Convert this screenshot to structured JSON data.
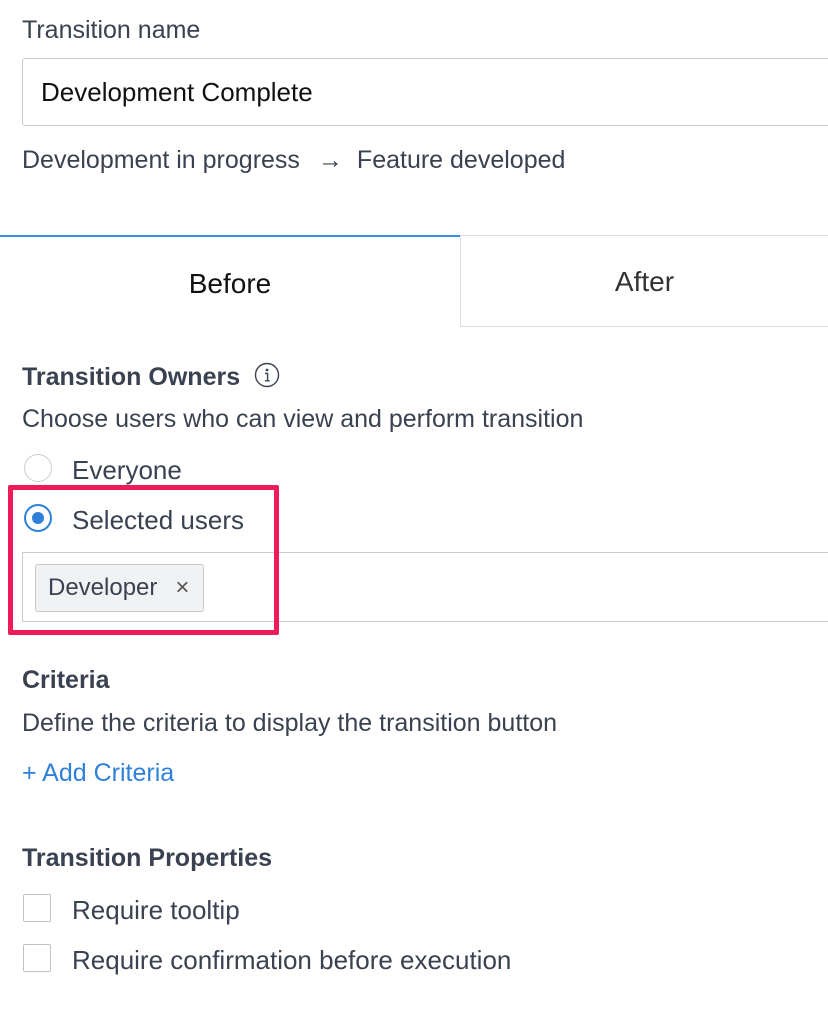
{
  "transition_name": {
    "label": "Transition name",
    "value": "Development Complete"
  },
  "path": {
    "from": "Development in progress",
    "arrow": "→",
    "to": "Feature developed"
  },
  "tabs": [
    {
      "label": "Before",
      "active": true
    },
    {
      "label": "After",
      "active": false
    }
  ],
  "owners": {
    "title": "Transition Owners",
    "info_icon": "info-circle-icon",
    "description": "Choose users who can view and perform transition",
    "options": [
      {
        "label": "Everyone",
        "selected": false
      },
      {
        "label": "Selected users",
        "selected": true
      }
    ],
    "chips": [
      {
        "label": "Developer",
        "remove": "×"
      }
    ]
  },
  "criteria": {
    "title": "Criteria",
    "description": "Define the criteria to display the transition button",
    "add_link": "+ Add Criteria"
  },
  "properties": {
    "title": "Transition Properties",
    "options": [
      {
        "label": "Require tooltip",
        "checked": false
      },
      {
        "label": "Require confirmation before execution",
        "checked": false
      }
    ]
  },
  "colors": {
    "accent": "#2f80d8",
    "highlight": "#ee1a5a",
    "text": "#3a4150"
  }
}
